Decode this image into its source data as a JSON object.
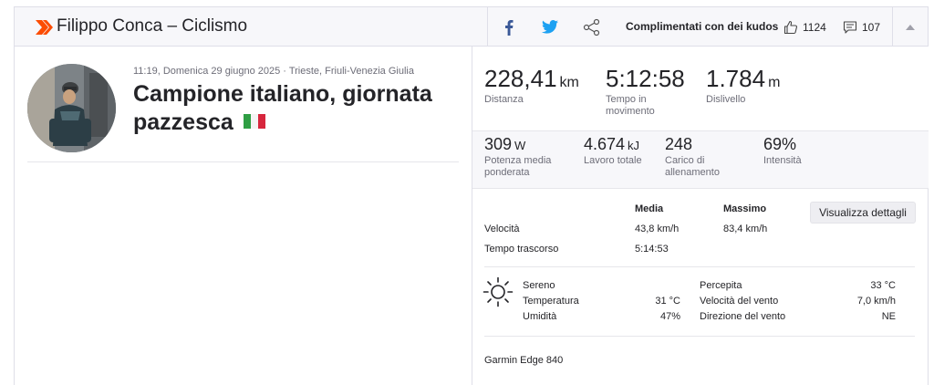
{
  "header": {
    "title": "Filippo Conca – Ciclismo",
    "kudos_prompt": "Complimentati con dei kudos",
    "kudos_count": "1124",
    "comments_count": "107",
    "icons": [
      "strava-chevron-icon",
      "facebook-icon",
      "twitter-icon",
      "share-icon",
      "thumbs-up-icon",
      "comment-icon",
      "chevron-up-icon"
    ],
    "brand_color": "#fc4c02"
  },
  "activity": {
    "meta": "11:19, Domenica 29 giugno 2025 · Trieste, Friuli-Venezia Giulia",
    "title": "Campione italiano, giornata pazzesca"
  },
  "stats_primary": [
    {
      "value": "228,41",
      "unit": "km",
      "label": "Distanza"
    },
    {
      "value": "5:12:58",
      "unit": "",
      "label": "Tempo in movimento"
    },
    {
      "value": "1.784",
      "unit": "m",
      "label": "Dislivello"
    }
  ],
  "stats_secondary": [
    {
      "value": "309",
      "unit": "W",
      "label": "Potenza media ponderata"
    },
    {
      "value": "4.674",
      "unit": "kJ",
      "label": "Lavoro totale"
    },
    {
      "value": "248",
      "unit": "",
      "label": "Carico di allenamento"
    },
    {
      "value": "69%",
      "unit": "",
      "label": "Intensità"
    }
  ],
  "details": {
    "col_avg": "Media",
    "col_max": "Massimo",
    "button": "Visualizza dettagli",
    "rows": [
      {
        "label": "Velocità",
        "avg": "43,8 km/h",
        "max": "83,4 km/h"
      },
      {
        "label": "Tempo trascorso",
        "avg": "5:14:53",
        "max": ""
      }
    ]
  },
  "weather": {
    "icon": "sun-icon",
    "condition": "Sereno",
    "temperature_label": "Temperatura",
    "temperature": "31 °C",
    "humidity_label": "Umidità",
    "humidity": "47%",
    "feels_label": "Percepita",
    "feels": "33 °C",
    "wind_speed_label": "Velocità del vento",
    "wind_speed": "7,0 km/h",
    "wind_dir_label": "Direzione del vento",
    "wind_dir": "NE"
  },
  "device": "Garmin Edge 840"
}
